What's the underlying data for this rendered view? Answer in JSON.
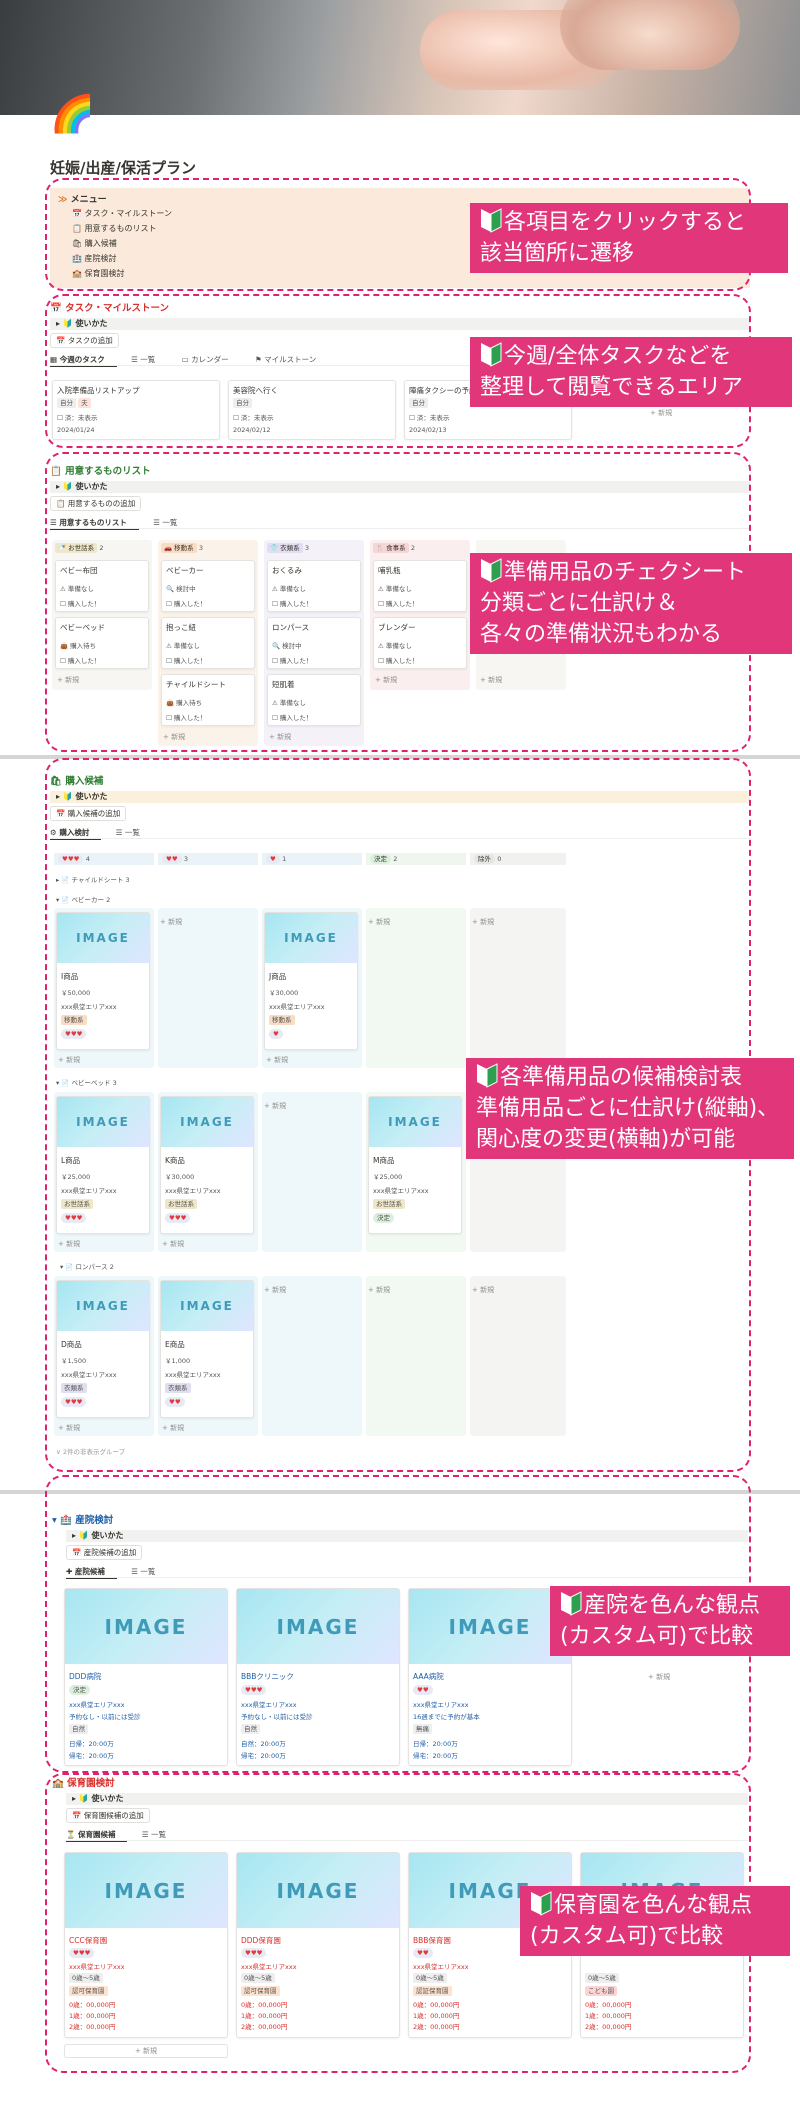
{
  "page": {
    "title": "妊娠/出産/保活プラン",
    "icon": "rainbow-icon"
  },
  "menu": {
    "label": "メニュー",
    "items": [
      "タスク・マイルストーン",
      "用意するものリスト",
      "購入候補",
      "産院検討",
      "保育園検討"
    ]
  },
  "overlays": {
    "menu": "各項目をクリックすると\n該当箇所に遷移",
    "tasks": "今週/全体タスクなどを\n整理して閲覧できるエリア",
    "prep": "準備用品のチェクシート\n分類ごとに仕訳け＆\n各々の準備状況もわかる",
    "candidates": "各準備用品の候補検討表\n準備用品ごとに仕訳け(縦軸)、\n関心度の変更(横軸)が可能",
    "hospital": "産院を色んな観点\n(カスタム可)で比較",
    "nursery": "保育園を色んな観点\n(カスタム可)で比較"
  },
  "common": {
    "howto": "使いかた",
    "new": "+ 新規",
    "list_tab": "一覧",
    "todo_unset": "未表示",
    "purchased": "購入した！",
    "prep_none": "準備なし",
    "image_placeholder": "IMAGE"
  },
  "tasks": {
    "title": "タスク・マイルストーン",
    "add": "タスクの追加",
    "tabs": [
      "今週のタスク",
      "一覧",
      "カレンダー",
      "マイルストーン"
    ],
    "cards": [
      {
        "title": "入院準備品リストアップ",
        "who": "自分",
        "tag": "夫",
        "done": "済：",
        "date": "2024/01/24"
      },
      {
        "title": "美容院へ行く",
        "who": "自分",
        "tag": "",
        "done": "済：",
        "date": "2024/02/12"
      },
      {
        "title": "陣痛タクシーの予約",
        "who": "自分",
        "tag": "",
        "done": "済：",
        "date": "2024/02/13"
      }
    ]
  },
  "prep": {
    "title": "用意するものリスト",
    "add": "用意するものの追加",
    "tabs": [
      "用意するものリスト",
      "一覧"
    ],
    "columns": [
      {
        "name": "お世話系",
        "count": "2",
        "items": [
          {
            "name": "ベビー布団",
            "status": "準備なし"
          },
          {
            "name": "ベビーベッド",
            "status": "購入待ち"
          }
        ]
      },
      {
        "name": "移動系",
        "count": "3",
        "items": [
          {
            "name": "ベビーカー",
            "status": "検討中"
          },
          {
            "name": "抱っこ紐",
            "status": "準備なし"
          },
          {
            "name": "チャイルドシート",
            "status": "購入待ち"
          }
        ]
      },
      {
        "name": "衣類系",
        "count": "3",
        "items": [
          {
            "name": "おくるみ",
            "status": "準備なし"
          },
          {
            "name": "ロンパース",
            "status": "検討中"
          },
          {
            "name": "短肌着",
            "status": "準備なし"
          }
        ]
      },
      {
        "name": "食事系",
        "count": "2",
        "items": [
          {
            "name": "哺乳瓶",
            "status": "準備なし"
          },
          {
            "name": "ブレンダー",
            "status": "準備なし"
          }
        ]
      }
    ]
  },
  "candidates": {
    "title": "購入候補",
    "add": "購入候補の追加",
    "tabs": [
      "購入検討",
      "一覧"
    ],
    "columns": [
      {
        "label": "♥♥♥",
        "count": "4",
        "bg": "#eaf4f8"
      },
      {
        "label": "♥♥",
        "count": "3",
        "bg": "#eaf4f8"
      },
      {
        "label": "♥",
        "count": "1",
        "bg": "#eaf4f8"
      },
      {
        "label": "決定",
        "count": "2",
        "bg": "#eef6ee"
      },
      {
        "label": "除外",
        "count": "0",
        "bg": "#f1f1ef"
      }
    ],
    "groups": [
      {
        "name": "チャイルドシート",
        "count": "3"
      },
      {
        "name": "ベビーカー",
        "count": "2"
      },
      {
        "name": "ベビーベッド",
        "count": "3"
      },
      {
        "name": "ロンパース",
        "count": "2"
      }
    ],
    "items": [
      {
        "name": "I商品",
        "price": "￥50,000",
        "store": "xxx県堂エリアxxx",
        "cat": "移動系",
        "level": "♥♥♥"
      },
      {
        "name": "J商品",
        "price": "￥30,000",
        "store": "xxx県堂エリアxxx",
        "cat": "移動系",
        "level": "♥"
      },
      {
        "name": "L商品",
        "price": "￥25,000",
        "store": "xxx県堂エリアxxx",
        "cat": "お世話系",
        "level": "♥♥♥"
      },
      {
        "name": "K商品",
        "price": "￥30,000",
        "store": "xxx県堂エリアxxx",
        "cat": "お世話系",
        "level": "♥♥♥"
      },
      {
        "name": "M商品",
        "price": "￥25,000",
        "store": "xxx県堂エリアxxx",
        "cat": "お世話系",
        "level": "決定"
      },
      {
        "name": "D商品",
        "price": "￥1,500",
        "store": "xxx県堂エリアxxx",
        "cat": "衣類系",
        "level": "♥♥♥"
      },
      {
        "name": "E商品",
        "price": "￥1,000",
        "store": "xxx県堂エリアxxx",
        "cat": "衣類系",
        "level": "♥♥"
      }
    ],
    "hidden_groups": "2件の非表示グループ"
  },
  "hospital": {
    "title": "産院検討",
    "add": "産院候補の追加",
    "tabs": [
      "産院候補",
      "一覧"
    ],
    "cards": [
      {
        "name": "DDD病院",
        "badge": "決定",
        "area": "xxx県堂エリアxxx",
        "note": "予約なし・以前には受診",
        "type": "自然",
        "d1": "日帰：20:00万",
        "d2": "帰宅：20:00万"
      },
      {
        "name": "BBBクリニック",
        "badge": "♥♥♥",
        "area": "xxx県堂エリアxxx",
        "note": "予約なし・以前には受診",
        "type": "自然",
        "d1": "自然：20:00万",
        "d2": "帰宅：20:00万"
      },
      {
        "name": "AAA病院",
        "badge": "♥♥",
        "area": "xxx県堂エリアxxx",
        "note": "16週までに予約が基本",
        "type": "無痛",
        "d1": "日帰：20:00万",
        "d2": "帰宅：20:00万"
      }
    ]
  },
  "nursery": {
    "title": "保育園検討",
    "add": "保育園候補の追加",
    "tabs": [
      "保育園候補",
      "一覧"
    ],
    "cards": [
      {
        "name": "CCC保育園",
        "badge": "♥♥♥",
        "area": "xxx県堂エリアxxx",
        "age": "0歳〜5歳",
        "type": "認可保育園",
        "fees": [
          "0歳：00,000円",
          "1歳：00,000円",
          "2歳：00,000円"
        ]
      },
      {
        "name": "DDD保育園",
        "badge": "♥♥♥",
        "area": "xxx県堂エリアxxx",
        "age": "0歳〜5歳",
        "type": "認可保育園",
        "fees": [
          "0歳：00,000円",
          "1歳：00,000円",
          "2歳：00,000円"
        ]
      },
      {
        "name": "BBB保育園",
        "badge": "♥♥",
        "area": "xxx県堂エリアxxx",
        "age": "0歳〜5歳",
        "type": "認証保育園",
        "fees": [
          "0歳：00,000円",
          "1歳：00,000円",
          "2歳：00,000円"
        ]
      },
      {
        "name": "",
        "badge": "",
        "area": "",
        "age": "0歳〜5歳",
        "type": "こども園",
        "fees": [
          "0歳：00,000円",
          "1歳：00,000円",
          "2歳：00,000円"
        ]
      }
    ]
  },
  "colors": {
    "accent": "#e2367a",
    "frame": "#e0226e",
    "menu_bg": "#fbeadb",
    "title_red": "#d9302c"
  }
}
